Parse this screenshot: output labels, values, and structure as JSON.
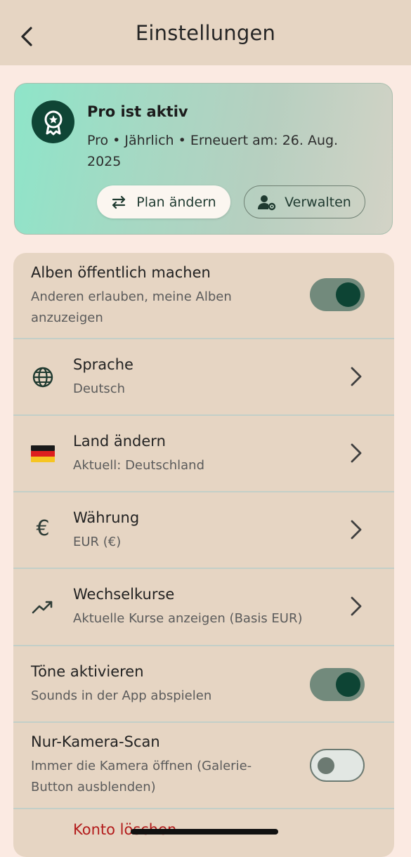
{
  "header": {
    "title": "Einstellungen"
  },
  "pro": {
    "title": "Pro ist aktiv",
    "subtitle": "Pro • Jährlich • Erneuert am: 26. Aug. 2025",
    "change_plan_label": "Plan ändern",
    "manage_label": "Verwalten"
  },
  "settings": {
    "public_albums": {
      "title": "Alben öffentlich machen",
      "subtitle": "Anderen erlauben, meine Alben anzuzeigen",
      "enabled": true
    },
    "language": {
      "title": "Sprache",
      "value": "Deutsch"
    },
    "country": {
      "title": "Land ändern",
      "value": "Aktuell: Deutschland"
    },
    "currency": {
      "title": "Währung",
      "value": "EUR (€)",
      "symbol": "€"
    },
    "rates": {
      "title": "Wechselkurse",
      "subtitle": "Aktuelle Kurse anzeigen (Basis EUR)"
    },
    "sounds": {
      "title": "Töne aktivieren",
      "subtitle": "Sounds in der App abspielen",
      "enabled": true
    },
    "camera_scan": {
      "title": "Nur-Kamera-Scan",
      "subtitle": "Immer die Kamera öffnen (Galerie-Button ausblenden)",
      "enabled": false
    },
    "delete_account": {
      "title": "Konto löschen"
    }
  },
  "colors": {
    "accent_dark": "#0f4535",
    "danger": "#b31b1b",
    "toggle_on": "#728a7c"
  }
}
